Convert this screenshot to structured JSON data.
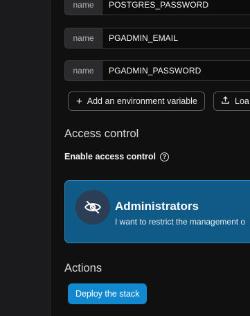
{
  "env_vars": [
    {
      "key": "name",
      "value": "POSTGRES_PASSWORD"
    },
    {
      "key": "name",
      "value": "PGADMIN_EMAIL"
    },
    {
      "key": "name",
      "value": "PGADMIN_PASSWORD"
    }
  ],
  "env_actions": {
    "add_label": "Add an environment variable",
    "add_icon": "plus-icon",
    "load_label": "Loa",
    "load_icon": "upload-icon"
  },
  "access_control": {
    "section_title": "Access control",
    "enable_label": "Enable access control",
    "help_icon": "question-circle-icon",
    "card": {
      "icon": "eye-off-icon",
      "title": "Administrators",
      "description": "I want to restrict the management o"
    }
  },
  "actions": {
    "section_title": "Actions",
    "deploy_label": "Deploy the stack"
  },
  "colors": {
    "background": "#101011",
    "card_background": "#0f5a86",
    "card_border": "#2f88c0",
    "primary_button": "#1288cf"
  }
}
